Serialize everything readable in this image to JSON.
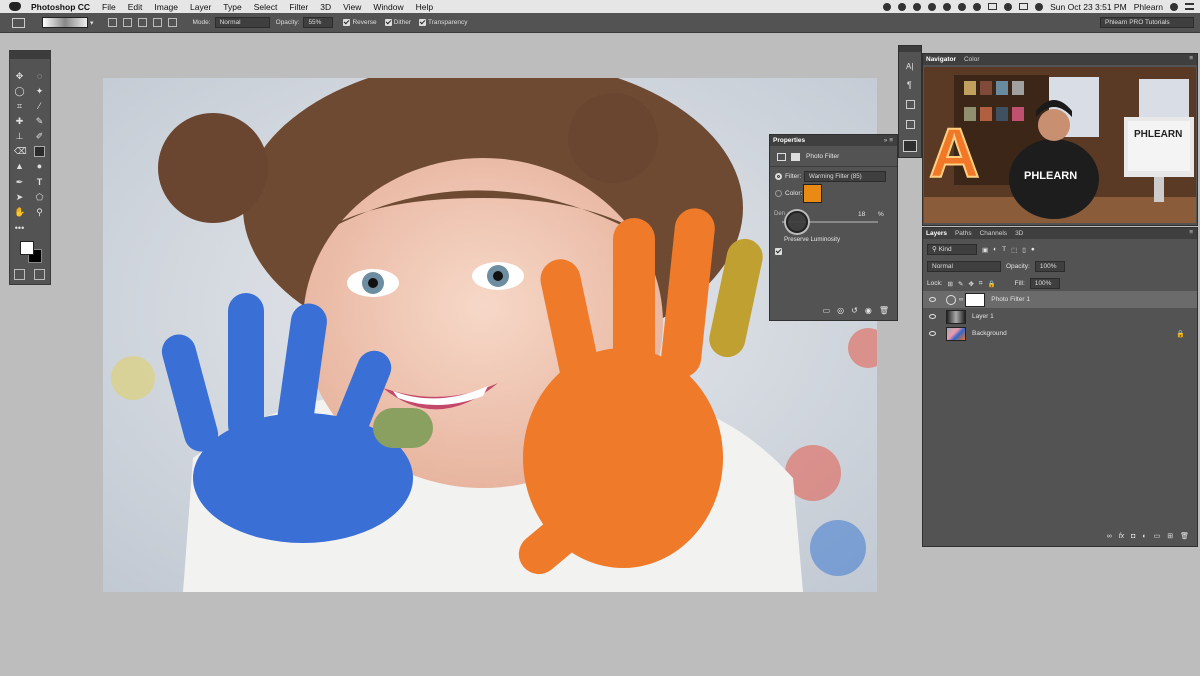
{
  "menubar": {
    "app_name": "Photoshop CC",
    "items": [
      "File",
      "Edit",
      "Image",
      "Layer",
      "Type",
      "Select",
      "Filter",
      "3D",
      "View",
      "Window",
      "Help"
    ],
    "clock": "Sun Oct 23  3:51 PM",
    "user": "Phlearn"
  },
  "options_bar": {
    "mode_label": "Mode:",
    "mode_value": "Normal",
    "opacity_label": "Opacity:",
    "opacity_value": "55%",
    "reverse_label": "Reverse",
    "dither_label": "Dither",
    "transparency_label": "Transparency",
    "workspace": "Phlearn PRO Tutorials"
  },
  "properties": {
    "title": "Properties",
    "subtitle": "Photo Filter",
    "filter_label": "Filter:",
    "filter_value": "Warming Filter (85)",
    "color_label": "Color:",
    "color_swatch": "#e88a14",
    "density_label": "Density:",
    "density_visible": "Den",
    "density_value": "18",
    "density_unit": "%",
    "preserve_label": "Preserve Luminosity"
  },
  "navigator": {
    "tabs": [
      "Navigator",
      "Color"
    ],
    "presenter_sign": "PHLEARN",
    "presenter_shirt": "PHLEARN",
    "marquee_letter": "A"
  },
  "layers": {
    "tabs": [
      "Layers",
      "Paths",
      "Channels",
      "3D"
    ],
    "kind_label": "Kind",
    "blend_mode": "Normal",
    "opacity_label": "Opacity:",
    "opacity_value": "100%",
    "lock_label": "Lock:",
    "fill_label": "Fill:",
    "fill_value": "100%",
    "rows": [
      {
        "name": "Photo Filter 1"
      },
      {
        "name": "Layer 1"
      },
      {
        "name": "Background"
      }
    ]
  },
  "colors": {
    "ui_panel": "#535353",
    "ui_dark": "#3f3f3f",
    "accent_orange": "#e88a14"
  }
}
